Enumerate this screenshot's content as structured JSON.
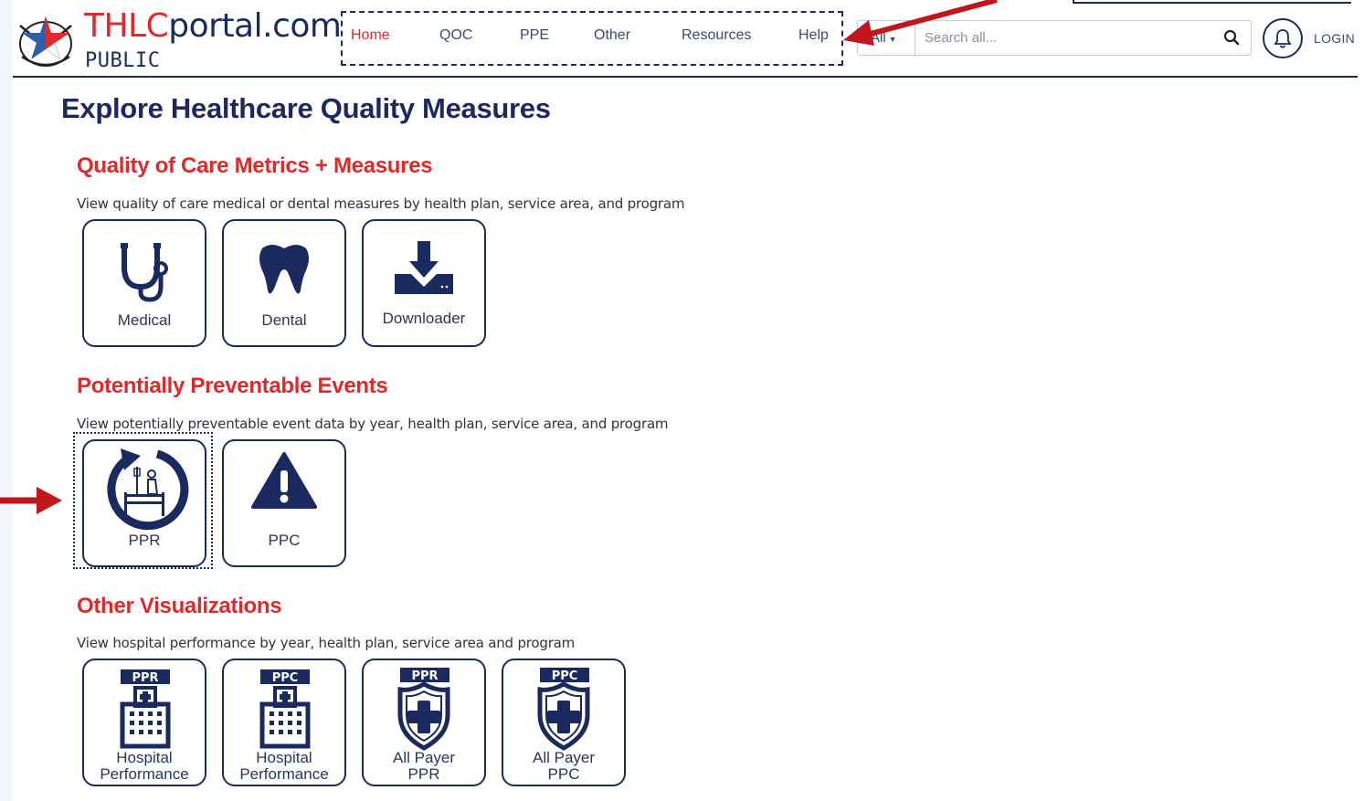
{
  "header": {
    "logo_thlc": "THLC",
    "logo_rest": "portal.com",
    "logo_sub": "PUBLIC",
    "nav": [
      {
        "label": "Home",
        "active": true
      },
      {
        "label": "QOC"
      },
      {
        "label": "PPE"
      },
      {
        "label": "Other"
      },
      {
        "label": "Resources"
      },
      {
        "label": "Help"
      }
    ],
    "search_scope": "All",
    "search_placeholder": "Search all...",
    "login": "LOGIN"
  },
  "page_title": "Explore Healthcare Quality Measures",
  "sections": [
    {
      "title": "Quality of Care Metrics + Measures",
      "desc": "View quality of care medical or dental measures by health plan, service area, and program",
      "tiles": [
        {
          "label": "Medical",
          "icon": "stethoscope-icon"
        },
        {
          "label": "Dental",
          "icon": "tooth-icon"
        },
        {
          "label": "Downloader",
          "icon": "download-icon"
        }
      ]
    },
    {
      "title": "Potentially Preventable Events",
      "desc": "View potentially preventable event data by year, health plan, service area, and program",
      "tiles": [
        {
          "label": "PPR",
          "icon": "readmission-bed-icon"
        },
        {
          "label": "PPC",
          "icon": "warning-icon"
        }
      ]
    },
    {
      "title": "Other Visualizations",
      "desc": "View hospital performance by year, health plan, service area and program",
      "tiles": [
        {
          "label_line1": "Hospital",
          "label_line2": "Performance",
          "badge": "PPR",
          "icon": "hospital-icon"
        },
        {
          "label_line1": "Hospital",
          "label_line2": "Performance",
          "badge": "PPC",
          "icon": "hospital-icon"
        },
        {
          "label_line1": "All Payer",
          "label_line2": "PPR",
          "badge": "PPR",
          "icon": "shield-cross-icon"
        },
        {
          "label_line1": "All Payer",
          "label_line2": "PPC",
          "badge": "PPC",
          "icon": "shield-cross-icon"
        }
      ]
    }
  ],
  "colors": {
    "navy": "#1b2a5e",
    "accent_red": "#e02a2a",
    "annotation_red": "#c0161c"
  }
}
